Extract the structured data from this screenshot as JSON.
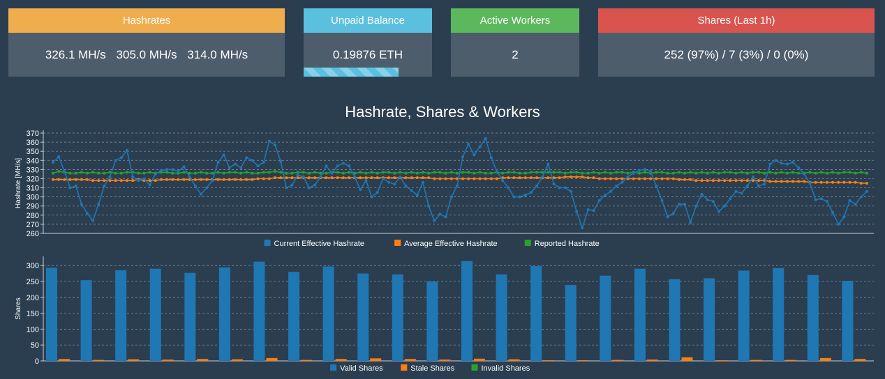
{
  "cards": {
    "hashrates": {
      "title": "Hashrates",
      "values": [
        "326.1 MH/s",
        "305.0 MH/s",
        "314.0 MH/s"
      ],
      "color": "#f0ad4e"
    },
    "unpaid": {
      "title": "Unpaid Balance",
      "value": "0.19876 ETH",
      "progress_pct": 74,
      "color": "#5bc0de"
    },
    "workers": {
      "title": "Active Workers",
      "value": "2",
      "color": "#5cb85c"
    },
    "shares": {
      "title": "Shares (Last 1h)",
      "value": "252 (97%) / 7 (3%) / 0 (0%)",
      "color": "#d9534f"
    }
  },
  "chart_title": "Hashrate, Shares & Workers",
  "chart_data": [
    {
      "type": "line",
      "ylabel": "Hashrate [MH/s]",
      "ylim": [
        260,
        370
      ],
      "yticks": [
        260,
        270,
        280,
        290,
        300,
        310,
        320,
        330,
        340,
        350,
        360,
        370
      ],
      "grid": true,
      "legend_position": "bottom",
      "series": [
        {
          "name": "Current Effective Hashrate",
          "color": "#1f77b4",
          "values": [
            338,
            344,
            328,
            310,
            312,
            292,
            282,
            274,
            292,
            312,
            322,
            340,
            343,
            351,
            322,
            318,
            320,
            313,
            325,
            329,
            330,
            330,
            328,
            333,
            322,
            312,
            303,
            310,
            318,
            338,
            346,
            332,
            336,
            332,
            343,
            340,
            334,
            338,
            361,
            357,
            339,
            310,
            313,
            324,
            322,
            310,
            313,
            322,
            334,
            326,
            334,
            337,
            334,
            322,
            308,
            318,
            300,
            305,
            320,
            316,
            314,
            322,
            312,
            307,
            302,
            316,
            290,
            274,
            281,
            278,
            300,
            312,
            344,
            358,
            346,
            355,
            364,
            343,
            328,
            318,
            310,
            300,
            300,
            302,
            305,
            312,
            322,
            336,
            314,
            310,
            310,
            306,
            284,
            266,
            286,
            285,
            296,
            302,
            306,
            312,
            316,
            322,
            326,
            329,
            330,
            328,
            312,
            296,
            278,
            282,
            292,
            292,
            272,
            290,
            303,
            297,
            295,
            284,
            290,
            298,
            306,
            304,
            312,
            322,
            312,
            314,
            336,
            340,
            337,
            336,
            338,
            332,
            325,
            315,
            297,
            298,
            295,
            283,
            270,
            278,
            296,
            292,
            300,
            306
          ]
        },
        {
          "name": "Average Effective Hashrate",
          "color": "#ff7f0e",
          "values": [
            319,
            319,
            319,
            319,
            319,
            319,
            319,
            318,
            318,
            318,
            318,
            318,
            318,
            318,
            318,
            319,
            318,
            318,
            318,
            319,
            319,
            319,
            319,
            319,
            319,
            319,
            319,
            319,
            319,
            319,
            319,
            319,
            319,
            319,
            319,
            319,
            320,
            320,
            320,
            321,
            321,
            321,
            321,
            321,
            321,
            321,
            321,
            321,
            321,
            321,
            321,
            321,
            321,
            321,
            321,
            321,
            321,
            321,
            321,
            321,
            321,
            321,
            321,
            321,
            321,
            321,
            321,
            320,
            320,
            320,
            320,
            320,
            320,
            320,
            320,
            320,
            320,
            320,
            320,
            321,
            321,
            321,
            321,
            321,
            321,
            321,
            321,
            321,
            321,
            321,
            322,
            322,
            322,
            322,
            321,
            321,
            320,
            320,
            320,
            320,
            320,
            320,
            320,
            320,
            320,
            320,
            320,
            320,
            320,
            320,
            319,
            319,
            319,
            318,
            318,
            318,
            318,
            318,
            318,
            318,
            318,
            318,
            318,
            318,
            318,
            318,
            317,
            317,
            317,
            317,
            317,
            317,
            317,
            316,
            316,
            316,
            316,
            316,
            316,
            316,
            316,
            316,
            315,
            315
          ]
        },
        {
          "name": "Reported Hashrate",
          "color": "#2ca02c",
          "values": [
            326,
            328,
            327,
            326,
            326,
            327,
            326,
            327,
            326,
            326,
            327,
            326,
            326,
            327,
            327,
            326,
            326,
            327,
            326,
            327,
            327,
            326,
            326,
            327,
            326,
            326,
            327,
            326,
            326,
            327,
            326,
            327,
            327,
            326,
            327,
            326,
            326,
            327,
            327,
            328,
            327,
            326,
            326,
            327,
            327,
            326,
            327,
            326,
            326,
            327,
            327,
            326,
            327,
            326,
            327,
            326,
            327,
            326,
            327,
            327,
            326,
            327,
            326,
            327,
            326,
            327,
            326,
            327,
            327,
            326,
            327,
            326,
            327,
            327,
            326,
            327,
            326,
            326,
            327,
            326,
            327,
            327,
            326,
            326,
            327,
            327,
            327,
            327,
            327,
            327,
            326,
            327,
            327,
            326,
            326,
            327,
            326,
            327,
            326,
            327,
            327,
            326,
            327,
            326,
            327,
            326,
            327,
            327,
            326,
            326,
            327,
            326,
            327,
            326,
            327,
            326,
            327,
            326,
            327,
            327,
            326,
            327,
            326,
            327,
            327,
            326,
            327,
            326,
            327,
            326,
            327,
            326,
            326,
            327,
            326,
            327,
            326,
            327,
            326,
            327,
            327,
            326,
            327,
            326
          ]
        }
      ]
    },
    {
      "type": "bar",
      "ylabel": "Shares",
      "ylim": [
        0,
        320
      ],
      "yticks": [
        0,
        50,
        100,
        150,
        200,
        250,
        300
      ],
      "grid": true,
      "legend_position": "bottom",
      "series": [
        {
          "name": "Valid Shares",
          "color": "#1f77b4",
          "values": [
            293,
            254,
            285,
            290,
            277,
            294,
            312,
            280,
            297,
            275,
            272,
            250,
            314,
            272,
            298,
            239,
            268,
            290,
            257,
            260,
            284,
            292,
            270,
            252
          ]
        },
        {
          "name": "Stale Shares",
          "color": "#ff7f0e",
          "values": [
            6,
            3,
            5,
            4,
            6,
            5,
            9,
            3,
            6,
            8,
            6,
            4,
            7,
            5,
            2,
            2,
            3,
            4,
            11,
            2,
            3,
            3,
            9,
            6
          ]
        },
        {
          "name": "Invalid Shares",
          "color": "#2ca02c",
          "values": [
            0,
            0,
            0,
            0,
            0,
            0,
            0,
            0,
            0,
            0,
            0,
            0,
            0,
            0,
            0,
            0,
            0,
            0,
            0,
            0,
            0,
            0,
            0,
            0
          ]
        }
      ]
    }
  ]
}
